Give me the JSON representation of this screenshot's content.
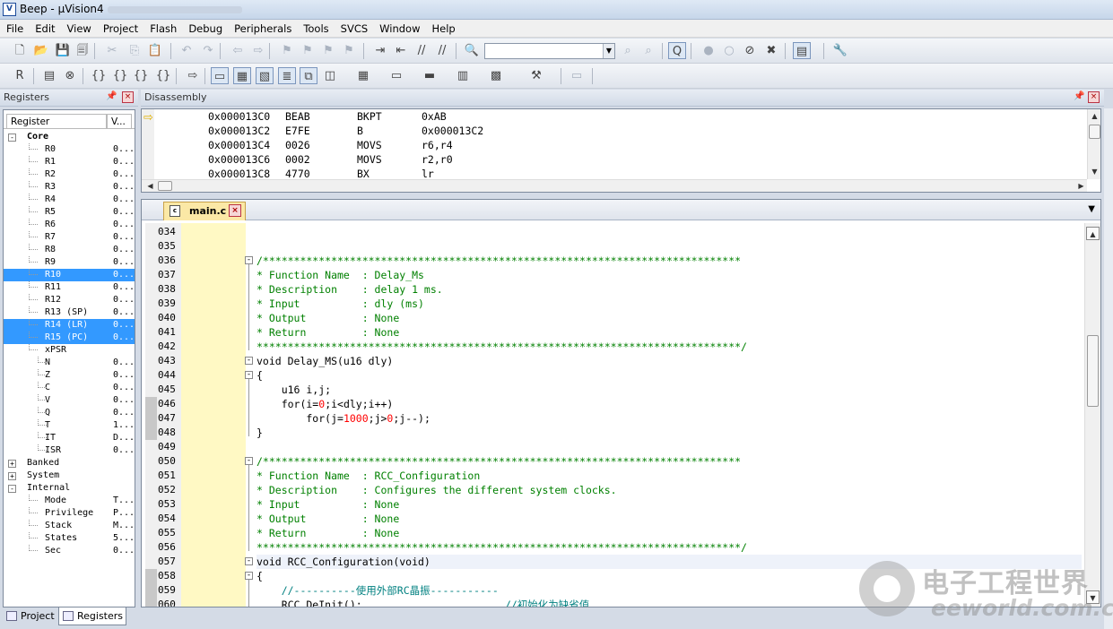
{
  "window": {
    "title": "Beep  -  µVision4",
    "icon": "uvision-app-icon"
  },
  "menu": [
    "File",
    "Edit",
    "View",
    "Project",
    "Flash",
    "Debug",
    "Peripherals",
    "Tools",
    "SVCS",
    "Window",
    "Help"
  ],
  "toolbar1": {
    "icons": [
      "new-file-icon",
      "open-folder-icon",
      "save-icon",
      "save-all-icon",
      "cut-icon",
      "copy-icon",
      "paste-icon",
      "undo-icon",
      "redo-icon",
      "nav-back-icon",
      "nav-forward-icon",
      "bookmark-icon",
      "bookmark-prev-icon",
      "bookmark-next-icon",
      "bookmark-clear-icon",
      "indent-icon",
      "unindent-icon",
      "comment-icon",
      "uncomment-icon",
      "find-in-files-icon",
      "find-icon",
      "incremental-find-icon",
      "debug-session-icon",
      "insert-breakpoint-icon",
      "enable-breakpoint-icon",
      "disable-breakpoints-icon",
      "kill-breakpoints-icon",
      "project-window-icon",
      "configure-icon"
    ],
    "search_value": ""
  },
  "toolbar2": {
    "icons": [
      "reset-icon",
      "run-icon",
      "stop-icon",
      "step-into-icon",
      "step-over-icon",
      "step-out-icon",
      "run-to-cursor-icon",
      "show-next-statement-icon",
      "command-window-icon",
      "disassembly-window-icon",
      "symbols-window-icon",
      "registers-window-icon",
      "call-stack-icon",
      "watch-window-icon",
      "memory-window-icon",
      "serial-window-icon",
      "analysis-window-icon",
      "trace-window-icon",
      "system-viewer-icon",
      "toolbox-icon",
      "debug-restore-icon"
    ]
  },
  "registers_panel": {
    "title": "Registers",
    "columns": [
      "Register",
      "V..."
    ],
    "rows": [
      {
        "name": "Core",
        "value": "",
        "level": 0,
        "expand": "-",
        "selected": false,
        "bold": true
      },
      {
        "name": "R0",
        "value": "0...",
        "level": 1,
        "selected": false
      },
      {
        "name": "R1",
        "value": "0...",
        "level": 1,
        "selected": false
      },
      {
        "name": "R2",
        "value": "0...",
        "level": 1,
        "selected": false
      },
      {
        "name": "R3",
        "value": "0...",
        "level": 1,
        "selected": false
      },
      {
        "name": "R4",
        "value": "0...",
        "level": 1,
        "selected": false
      },
      {
        "name": "R5",
        "value": "0...",
        "level": 1,
        "selected": false
      },
      {
        "name": "R6",
        "value": "0...",
        "level": 1,
        "selected": false
      },
      {
        "name": "R7",
        "value": "0...",
        "level": 1,
        "selected": false
      },
      {
        "name": "R8",
        "value": "0...",
        "level": 1,
        "selected": false
      },
      {
        "name": "R9",
        "value": "0...",
        "level": 1,
        "selected": false
      },
      {
        "name": "R10",
        "value": "0...",
        "level": 1,
        "selected": true
      },
      {
        "name": "R11",
        "value": "0...",
        "level": 1,
        "selected": false
      },
      {
        "name": "R12",
        "value": "0...",
        "level": 1,
        "selected": false
      },
      {
        "name": "R13 (SP)",
        "value": "0...",
        "level": 1,
        "selected": false
      },
      {
        "name": "R14 (LR)",
        "value": "0...",
        "level": 1,
        "selected": true
      },
      {
        "name": "R15 (PC)",
        "value": "0...",
        "level": 1,
        "selected": true
      },
      {
        "name": "xPSR",
        "value": "",
        "level": 1,
        "selected": false
      },
      {
        "name": "N",
        "value": "0...",
        "level": 2,
        "selected": false
      },
      {
        "name": "Z",
        "value": "0...",
        "level": 2,
        "selected": false
      },
      {
        "name": "C",
        "value": "0...",
        "level": 2,
        "selected": false
      },
      {
        "name": "V",
        "value": "0...",
        "level": 2,
        "selected": false
      },
      {
        "name": "Q",
        "value": "0...",
        "level": 2,
        "selected": false
      },
      {
        "name": "T",
        "value": "1...",
        "level": 2,
        "selected": false
      },
      {
        "name": "IT",
        "value": "D...",
        "level": 2,
        "selected": false
      },
      {
        "name": "ISR",
        "value": "0...",
        "level": 2,
        "selected": false
      },
      {
        "name": "Banked",
        "value": "",
        "level": 0,
        "expand": "+",
        "selected": false
      },
      {
        "name": "System",
        "value": "",
        "level": 0,
        "expand": "+",
        "selected": false
      },
      {
        "name": "Internal",
        "value": "",
        "level": 0,
        "expand": "-",
        "selected": false
      },
      {
        "name": "Mode",
        "value": "T...",
        "level": 1,
        "selected": false
      },
      {
        "name": "Privilege",
        "value": "P...",
        "level": 1,
        "selected": false
      },
      {
        "name": "Stack",
        "value": "M...",
        "level": 1,
        "selected": false
      },
      {
        "name": "States",
        "value": "5...",
        "level": 1,
        "selected": false
      },
      {
        "name": "Sec",
        "value": "0...",
        "level": 1,
        "selected": false
      }
    ],
    "tabs": [
      {
        "label": "Project",
        "active": false
      },
      {
        "label": "Registers",
        "active": true
      }
    ]
  },
  "disassembly": {
    "title": "Disassembly",
    "lines": [
      {
        "addr": "0x000013C0",
        "code": "BEAB",
        "mnem": "BKPT",
        "ops": "0xAB"
      },
      {
        "addr": "0x000013C2",
        "code": "E7FE",
        "mnem": "B",
        "ops": "0x000013C2"
      },
      {
        "addr": "0x000013C4",
        "code": "0026",
        "mnem": "MOVS",
        "ops": "r6,r4"
      },
      {
        "addr": "0x000013C6",
        "code": "0002",
        "mnem": "MOVS",
        "ops": "r2,r0"
      },
      {
        "addr": "0x000013C8",
        "code": "4770",
        "mnem": "BX",
        "ops": "lr"
      }
    ]
  },
  "editor": {
    "tab": "main.c",
    "lines": [
      {
        "n": "034",
        "parts": []
      },
      {
        "n": "035",
        "parts": []
      },
      {
        "n": "036",
        "parts": [
          {
            "t": "/*****************************************************************************",
            "c": "cm"
          }
        ]
      },
      {
        "n": "037",
        "parts": [
          {
            "t": "* Function Name  : Delay_Ms",
            "c": "cm"
          }
        ]
      },
      {
        "n": "038",
        "parts": [
          {
            "t": "* Description    : delay 1 ms.",
            "c": "cm"
          }
        ]
      },
      {
        "n": "039",
        "parts": [
          {
            "t": "* Input          : dly (ms)",
            "c": "cm"
          }
        ]
      },
      {
        "n": "040",
        "parts": [
          {
            "t": "* Output         : None",
            "c": "cm"
          }
        ]
      },
      {
        "n": "041",
        "parts": [
          {
            "t": "* Return         : None",
            "c": "cm"
          }
        ]
      },
      {
        "n": "042",
        "parts": [
          {
            "t": "******************************************************************************/",
            "c": "cm"
          }
        ]
      },
      {
        "n": "043",
        "parts": [
          {
            "t": "void Delay_MS(u16 dly)",
            "c": "kw"
          }
        ]
      },
      {
        "n": "044",
        "parts": [
          {
            "t": "{",
            "c": "kw"
          }
        ]
      },
      {
        "n": "045",
        "parts": [
          {
            "t": "    u16 i,j;",
            "c": "kw"
          }
        ]
      },
      {
        "n": "046",
        "parts": [
          {
            "t": "    for(i=",
            "c": "kw"
          },
          {
            "t": "0",
            "c": "num"
          },
          {
            "t": ";i<dly;i++)",
            "c": "kw"
          }
        ]
      },
      {
        "n": "047",
        "parts": [
          {
            "t": "        for(j=",
            "c": "kw"
          },
          {
            "t": "1000",
            "c": "num"
          },
          {
            "t": ";j>",
            "c": "kw"
          },
          {
            "t": "0",
            "c": "num"
          },
          {
            "t": ";j--);",
            "c": "kw"
          }
        ]
      },
      {
        "n": "048",
        "parts": [
          {
            "t": "}",
            "c": "kw"
          }
        ]
      },
      {
        "n": "049",
        "parts": []
      },
      {
        "n": "050",
        "parts": [
          {
            "t": "/*****************************************************************************",
            "c": "cm"
          }
        ]
      },
      {
        "n": "051",
        "parts": [
          {
            "t": "* Function Name  : RCC_Configuration",
            "c": "cm"
          }
        ]
      },
      {
        "n": "052",
        "parts": [
          {
            "t": "* Description    : Configures the different system clocks.",
            "c": "cm"
          }
        ]
      },
      {
        "n": "053",
        "parts": [
          {
            "t": "* Input          : None",
            "c": "cm"
          }
        ]
      },
      {
        "n": "054",
        "parts": [
          {
            "t": "* Output         : None",
            "c": "cm"
          }
        ]
      },
      {
        "n": "055",
        "parts": [
          {
            "t": "* Return         : None",
            "c": "cm"
          }
        ]
      },
      {
        "n": "056",
        "parts": [
          {
            "t": "******************************************************************************/",
            "c": "cm"
          }
        ]
      },
      {
        "n": "057",
        "parts": [
          {
            "t": "void RCC_Configuration(void)",
            "c": "kw"
          }
        ]
      },
      {
        "n": "058",
        "parts": [
          {
            "t": "{",
            "c": "kw"
          }
        ]
      },
      {
        "n": "059",
        "parts": [
          {
            "t": "    //----------使用外部RC晶振-----------",
            "c": "ch"
          }
        ]
      },
      {
        "n": "060",
        "parts": [
          {
            "t": "    RCC_DeInit();                       ",
            "c": "kw"
          },
          {
            "t": "//初始化为缺省值",
            "c": "ch"
          }
        ]
      }
    ]
  },
  "watermark": {
    "line1": "电子工程世界",
    "line2": "eeworld.com.cn"
  }
}
